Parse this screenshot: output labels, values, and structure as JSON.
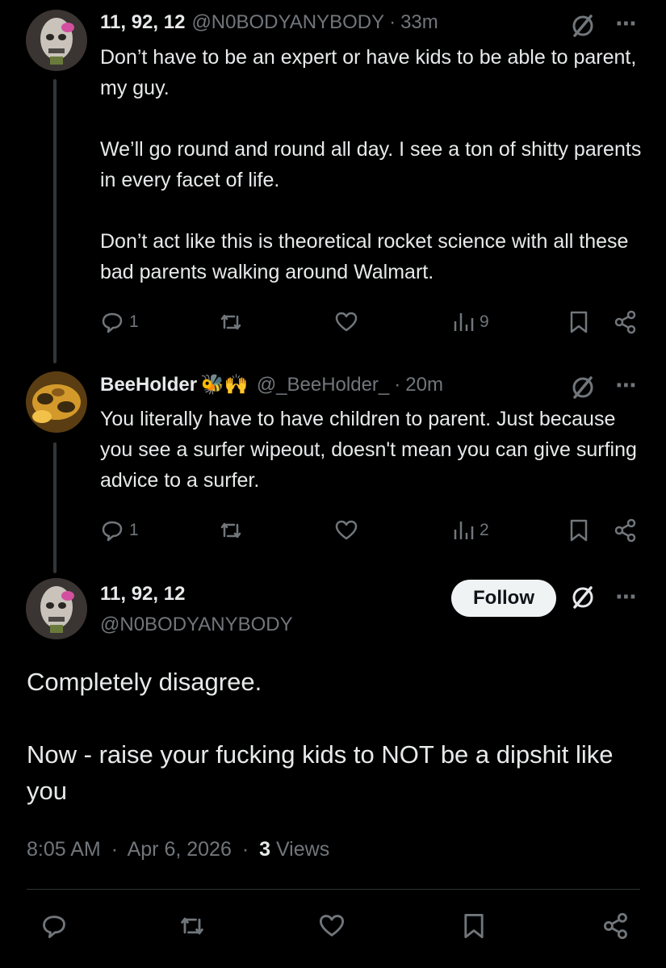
{
  "reply1": {
    "name": "11, 92, 12",
    "handle": "@N0BODYANYBODY",
    "time": "33m",
    "paragraphs": [
      "Don’t have to be an expert or have kids to be able to parent, my guy.",
      "We’ll go round and round all day. I see a ton of shitty parents in every facet of life.",
      "Don’t act like this is theoretical rocket science with all these bad parents walking around Walmart."
    ],
    "replies": "1",
    "views": "9"
  },
  "reply2": {
    "name": "BeeHolder",
    "name_emoji": "🐝🙌",
    "handle": "@_BeeHolder_",
    "time": "20m",
    "paragraphs": [
      "You literally have to have children to parent. Just because you see a surfer wipeout, doesn't mean you can give surfing advice to a surfer."
    ],
    "replies": "1",
    "views": "2"
  },
  "main": {
    "name": "11, 92, 12",
    "handle": "@N0BODYANYBODY",
    "follow_label": "Follow",
    "paragraphs": [
      "Completely disagree.",
      "Now - raise your fucking kids to NOT be a dipshit like you"
    ],
    "time": "8:05 AM",
    "date": "Apr 6, 2026",
    "views_count": "3",
    "views_label": "Views"
  },
  "separator": "·",
  "colors": {
    "background": "#000000",
    "text": "#e7e9ea",
    "muted": "#71767b",
    "follow_bg": "#eff3f4"
  }
}
